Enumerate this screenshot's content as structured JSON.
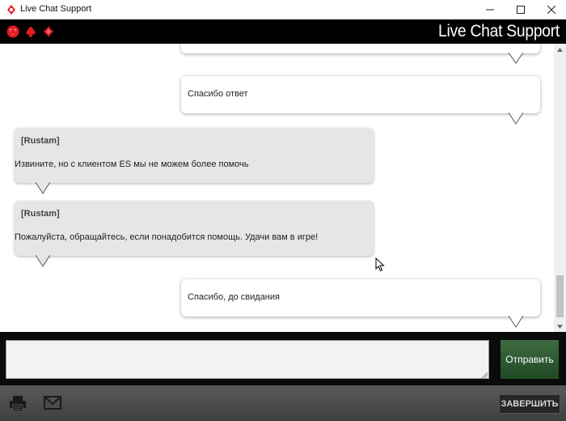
{
  "window": {
    "title": "Live Chat Support",
    "minimize_glyph": "—",
    "maximize_glyph": "☐",
    "close_glyph": "✕"
  },
  "header": {
    "title": "Live Chat Support",
    "suit_icons": [
      "heart-icon",
      "spade-icon",
      "diamond-icon"
    ],
    "suit_color": "#e31b23"
  },
  "messages": [
    {
      "from": "user",
      "text": ""
    },
    {
      "from": "user",
      "text": "Спасибо ответ"
    },
    {
      "from": "agent",
      "sender": "[Rustam]",
      "text": "Извините, но с клиентом ES мы не можем более помочь"
    },
    {
      "from": "agent",
      "sender": "[Rustam]",
      "text": "Пожалуйста, обращайтесь, если понадобится помощь. Удачи вам в игре!"
    },
    {
      "from": "user",
      "text": "Спасибо, до свидания"
    }
  ],
  "input": {
    "value": "",
    "placeholder": ""
  },
  "send_button": {
    "label": "Отправить",
    "color": "#2e5a31"
  },
  "toolbar": {
    "print_icon": "printer-icon",
    "email_icon": "envelope-icon",
    "end_label": "ЗАВЕРШИТЬ"
  }
}
